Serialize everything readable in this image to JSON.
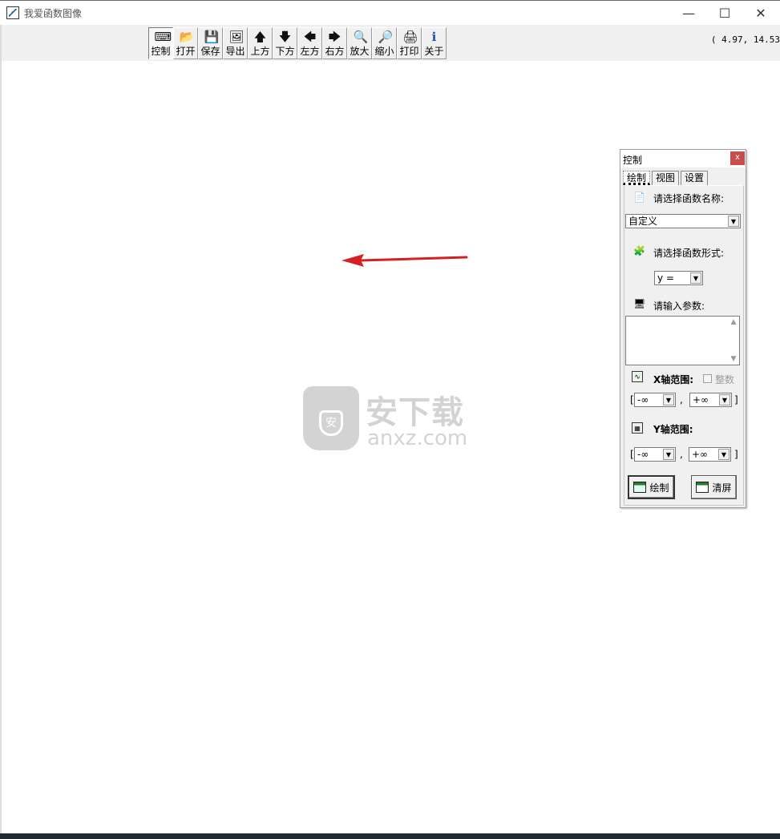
{
  "window": {
    "title": "我爱函数图像",
    "minimize": "—",
    "maximize": "☐",
    "close": "✕"
  },
  "toolbar": {
    "buttons": [
      {
        "label": "控制",
        "icon": "⌨",
        "icon_name": "keyboard-icon"
      },
      {
        "label": "打开",
        "icon": "📂",
        "icon_name": "open-folder-icon"
      },
      {
        "label": "保存",
        "icon": "💾",
        "icon_name": "save-disk-icon"
      },
      {
        "label": "导出",
        "icon": "🖼",
        "icon_name": "export-image-icon"
      },
      {
        "label": "上方",
        "icon": "🡅",
        "icon_name": "arrow-up-icon"
      },
      {
        "label": "下方",
        "icon": "🡇",
        "icon_name": "arrow-down-icon"
      },
      {
        "label": "左方",
        "icon": "🡄",
        "icon_name": "arrow-left-icon"
      },
      {
        "label": "右方",
        "icon": "🡆",
        "icon_name": "arrow-right-icon"
      },
      {
        "label": "放大",
        "icon": "🔍",
        "icon_name": "zoom-in-icon"
      },
      {
        "label": "缩小",
        "icon": "🔎",
        "icon_name": "zoom-out-icon"
      },
      {
        "label": "打印",
        "icon": "🖨",
        "icon_name": "printer-icon"
      },
      {
        "label": "关于",
        "icon": "ℹ",
        "icon_name": "info-icon"
      }
    ],
    "coords": "( 4.97, 14.53"
  },
  "watermark": {
    "brand": "安下载",
    "domain": "anxz.com",
    "shield_char": "安"
  },
  "panel": {
    "title": "控制",
    "close": "x",
    "tabs": [
      "绘制",
      "视图",
      "设置"
    ],
    "function_name_label": "请选择函数名称:",
    "function_name_value": "自定义",
    "function_form_label": "请选择函数形式:",
    "function_form_value": "y =",
    "params_label": "请输入参数:",
    "params_value": "",
    "x_range_label": "X轴范围:",
    "integer_label": "整数",
    "x_min": "-∞",
    "x_max": "+∞",
    "y_range_label": "Y轴范围:",
    "y_min": "-∞",
    "y_max": "+∞",
    "bracket_open": "[",
    "bracket_close": "]",
    "comma": ",",
    "draw_button": "绘制",
    "clear_button": "清屏"
  },
  "colors": {
    "accent_arrow": "#d42020",
    "close_red": "#c94b4b"
  }
}
